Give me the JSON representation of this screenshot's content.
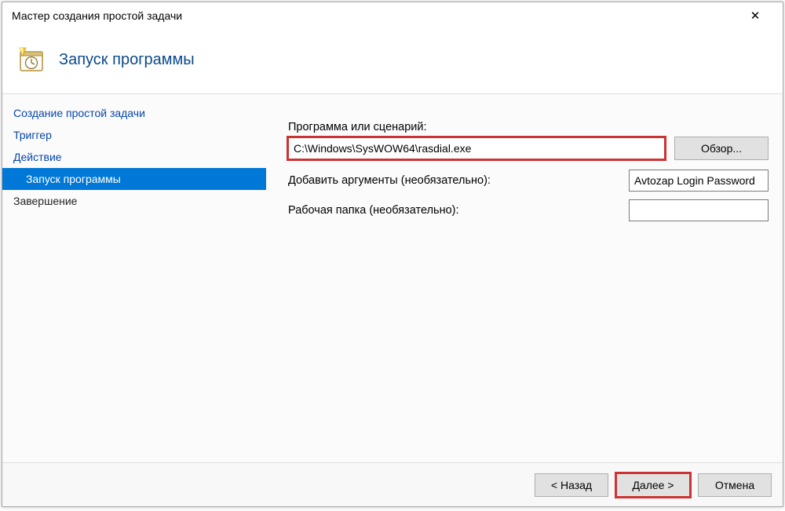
{
  "titlebar": {
    "text": "Мастер создания простой задачи"
  },
  "header": {
    "title": "Запуск программы"
  },
  "sidebar": {
    "items": [
      {
        "label": "Создание простой задачи",
        "selected": false,
        "link": true,
        "sub": false
      },
      {
        "label": "Триггер",
        "selected": false,
        "link": true,
        "sub": false
      },
      {
        "label": "Действие",
        "selected": false,
        "link": true,
        "sub": false
      },
      {
        "label": "Запуск программы",
        "selected": true,
        "link": false,
        "sub": true
      },
      {
        "label": "Завершение",
        "selected": false,
        "link": false,
        "sub": false
      }
    ]
  },
  "form": {
    "program_label": "Программа или сценарий:",
    "program_value": "C:\\Windows\\SysWOW64\\rasdial.exe",
    "browse_label": "Обзор...",
    "args_label": "Добавить аргументы (необязательно):",
    "args_value": "Avtozap Login Password",
    "workdir_label": "Рабочая папка (необязательно):",
    "workdir_value": ""
  },
  "footer": {
    "back": "< Назад",
    "next": "Далее >",
    "cancel": "Отмена"
  }
}
